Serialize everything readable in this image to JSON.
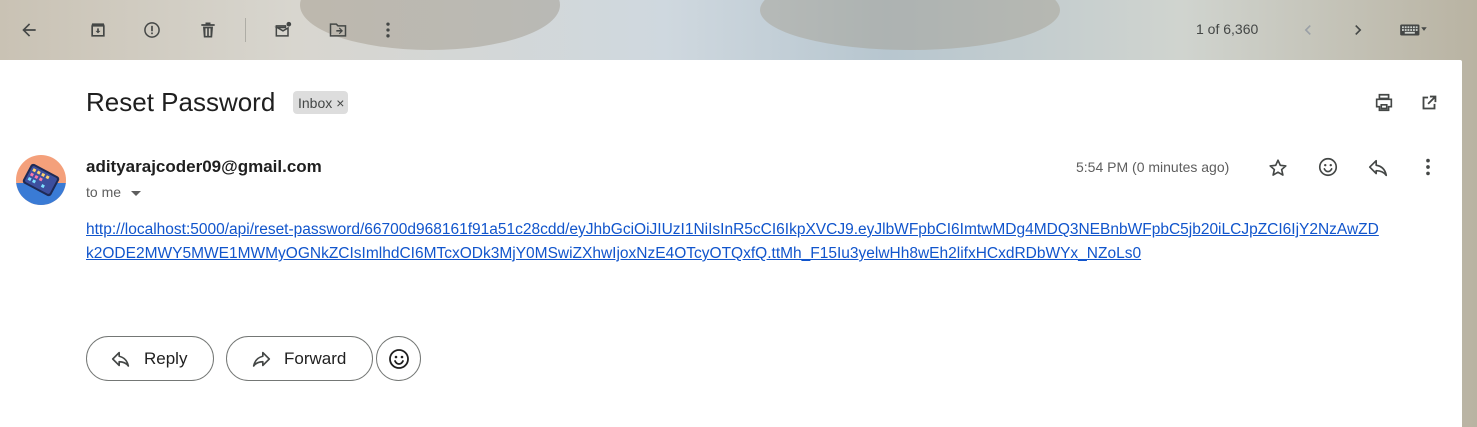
{
  "toolbar": {
    "pager_text": "1 of 6,360"
  },
  "message": {
    "subject": "Reset Password",
    "label": "Inbox",
    "label_remove": "×",
    "sender": "adityarajcoder09@gmail.com",
    "to_line": "to me",
    "time": "5:54 PM (0 minutes ago)",
    "body_link": "http://localhost:5000/api/reset-password/66700d968161f91a51c28cdd/eyJhbGciOiJIUzI1NiIsInR5cCI6IkpXVCJ9.eyJlbWFpbCI6ImtwMDg4MDQ3NEBnbWFpbC5jb20iLCJpZCI6IjY2NzAwZDk2ODE2MWY5MWE1MWMyOGNkZCIsImlhdCI6MTcxODk3MjY0MSwiZXhwIjoxNzE4OTcyOTQxfQ.ttMh_F15Iu3yelwHh8wEh2lifxHCxdRDbWYx_NZoLs0"
  },
  "actions": {
    "reply_label": "Reply",
    "forward_label": "Forward"
  },
  "colors": {
    "link": "#1155cc",
    "avatar_bg": "#f4a07b"
  }
}
